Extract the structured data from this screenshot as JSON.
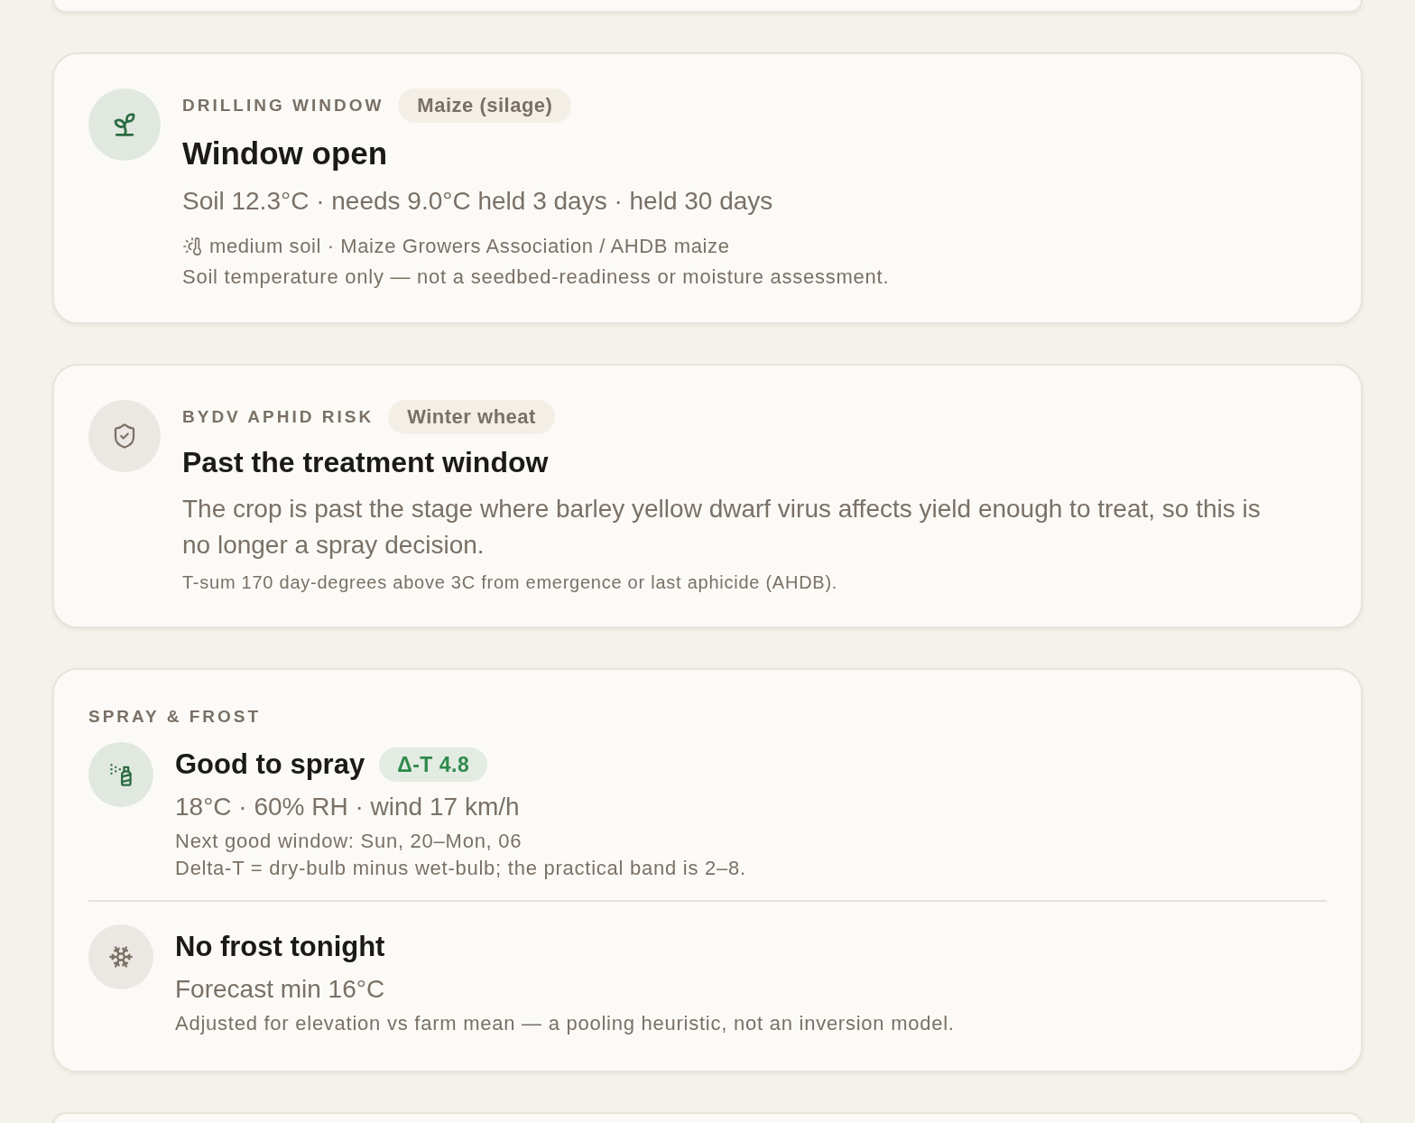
{
  "drilling_window": {
    "eyebrow": "DRILLING WINDOW",
    "crop": "Maize (silage)",
    "highlighted": true,
    "title": "Window open",
    "summary": "Soil 12.3°C · needs 9.0°C held 3 days · held 30 days",
    "source": "medium soil · Maize Growers Association / AHDB maize",
    "note": "Soil temperature only — not a seedbed-readiness or moisture assessment."
  },
  "bydv_aphid_risk": {
    "eyebrow": "BYDV APHID RISK",
    "crop": "Winter wheat",
    "highlighted": false,
    "title": "Past the treatment window",
    "summary": "The crop is past the stage where barley yellow dwarf virus affects yield enough to treat, so this is no longer a spray decision.",
    "note": "T-sum 170 day-degrees above 3C from emergence or last aphicide (AHDB)."
  },
  "spray_and_frost": {
    "heading": "SPRAY & FROST",
    "spray": {
      "highlighted": true,
      "title": "Good to spray",
      "badge": "Δ-T 4.8",
      "summary": "18°C · 60% RH · wind 17 km/h",
      "notes": [
        "Next good window: Sun, 20–Mon, 06",
        "Delta-T = dry-bulb minus wet-bulb; the practical band is 2–8."
      ]
    },
    "frost": {
      "highlighted": false,
      "title": "No frost tonight",
      "summary": "Forecast min 16°C",
      "notes": [
        "Adjusted for elevation vs farm mean — a pooling heuristic, not an inversion model."
      ]
    }
  }
}
